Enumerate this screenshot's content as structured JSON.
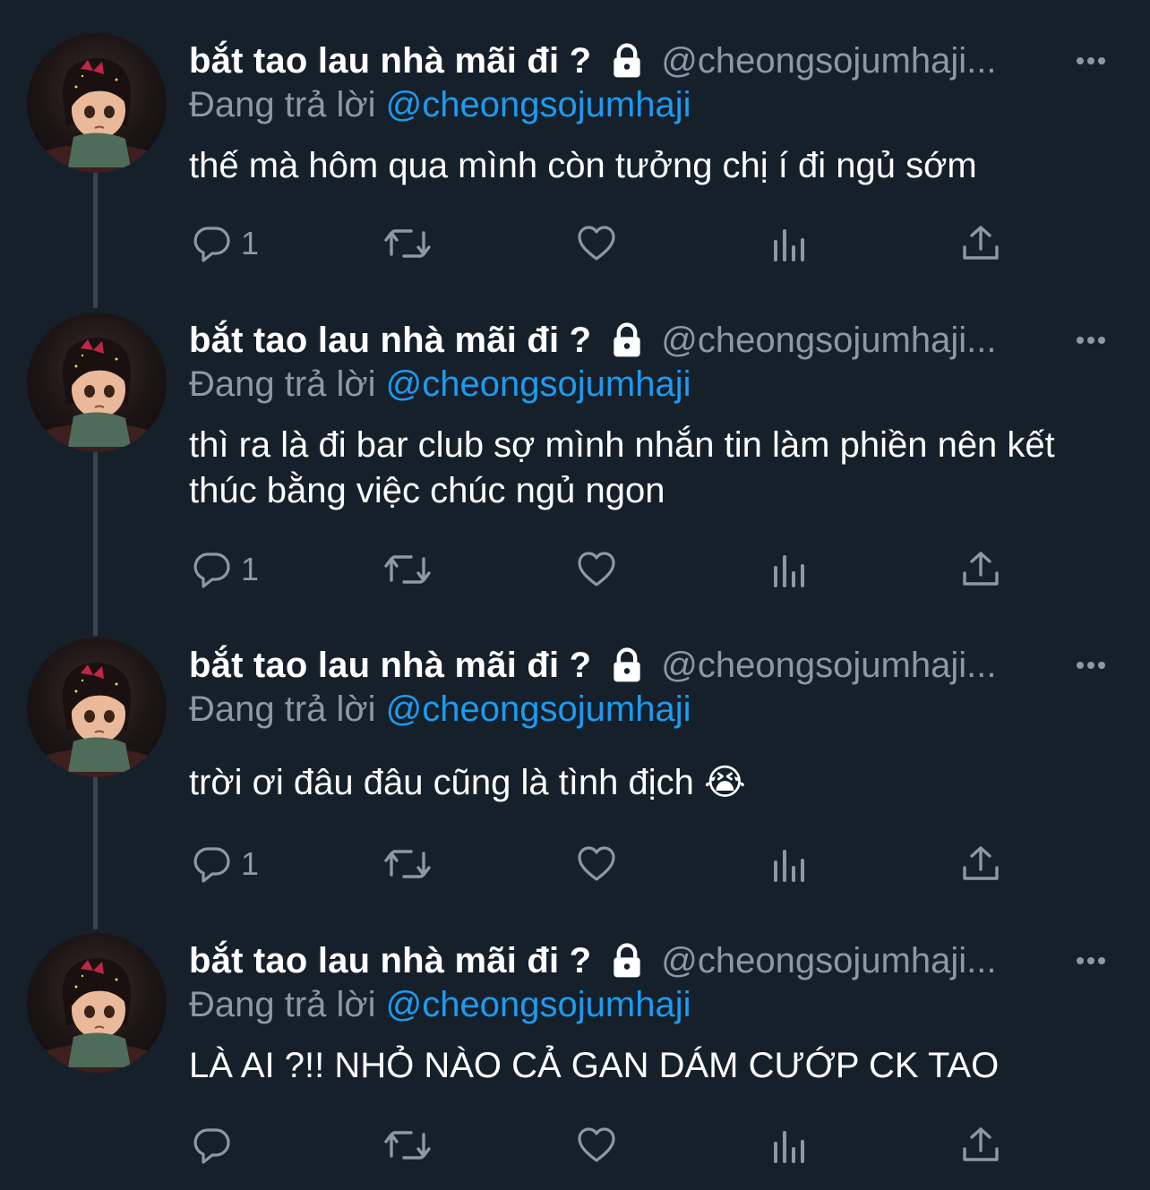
{
  "tweets": [
    {
      "name": "bắt tao lau nhà mãi đi ?",
      "handle": "@cheongsojumhaji...",
      "replying_prefix": "Đang trả lời",
      "replying_to": "@cheongsojumhaji",
      "text": "thế mà hôm qua mình còn tưởng chị í đi ngủ sớm",
      "reply_count": "1"
    },
    {
      "name": "bắt tao lau nhà mãi đi ?",
      "handle": "@cheongsojumhaji...",
      "replying_prefix": "Đang trả lời",
      "replying_to": "@cheongsojumhaji",
      "text": "thì ra là đi bar club sợ mình nhắn tin làm phiền nên kết thúc bằng việc chúc ngủ ngon",
      "reply_count": "1"
    },
    {
      "name": "bắt tao lau nhà mãi đi ?",
      "handle": "@cheongsojumhaji...",
      "replying_prefix": "Đang trả lời",
      "replying_to": "@cheongsojumhaji",
      "text": "trời ơi đâu đâu cũng là tình địch 😭",
      "reply_count": "1"
    },
    {
      "name": "bắt tao lau nhà mãi đi ?",
      "handle": "@cheongsojumhaji...",
      "replying_prefix": "Đang trả lời",
      "replying_to": "@cheongsojumhaji",
      "text": "LÀ AI ?!! NHỎ NÀO CẢ GAN DÁM CƯỚP CK TAO",
      "reply_count": ""
    }
  ],
  "icons": {
    "lock": "lock-icon",
    "more": "more-dots-icon",
    "reply": "reply-bubble-icon",
    "retweet": "retweet-icon",
    "like": "heart-icon",
    "views": "bar-chart-icon",
    "share": "share-upload-icon"
  },
  "colors": {
    "background": "#15202b",
    "text": "#ffffff",
    "secondary": "#8b98a5",
    "mention": "#1d9bf0",
    "thread_line": "#38444d"
  }
}
